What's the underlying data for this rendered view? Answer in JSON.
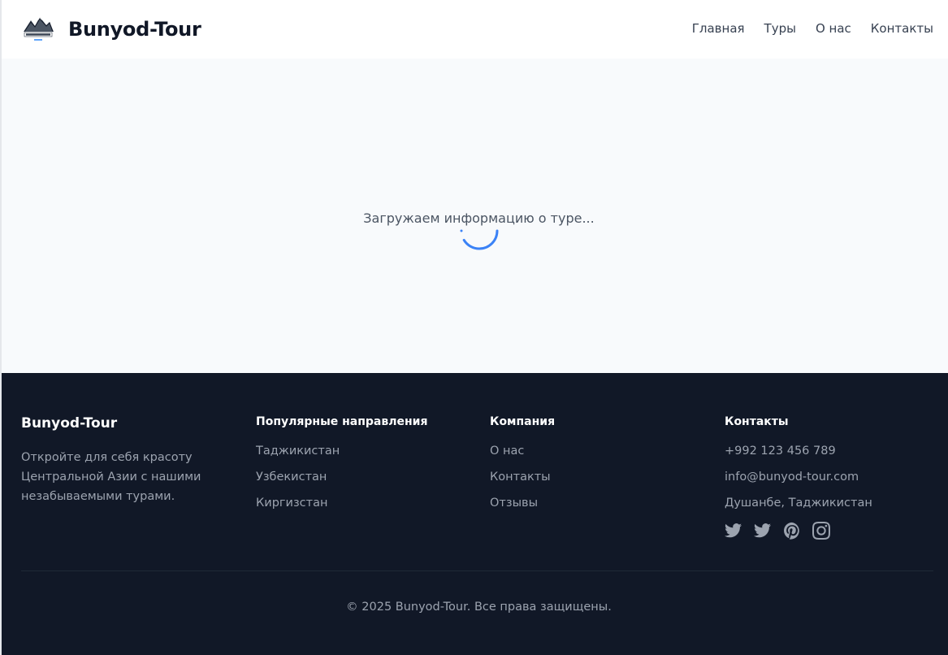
{
  "header": {
    "brand": "Bunyod-Tour",
    "nav": [
      "Главная",
      "Туры",
      "О нас",
      "Контакты"
    ]
  },
  "main": {
    "loading_text": "Загружаем информацию о туре..."
  },
  "footer": {
    "brand": "Bunyod-Tour",
    "description": "Откройте для себя красоту Центральной Азии с нашими незабываемыми турами.",
    "destinations": {
      "title": "Популярные направления",
      "items": [
        "Таджикистан",
        "Узбекистан",
        "Киргизстан"
      ]
    },
    "company": {
      "title": "Компания",
      "items": [
        "О нас",
        "Контакты",
        "Отзывы"
      ]
    },
    "contacts": {
      "title": "Контакты",
      "phone": "+992 123 456 789",
      "email": "info@bunyod-tour.com",
      "address": "Душанбе, Таджикистан"
    },
    "socials": [
      "twitter-icon",
      "twitter-icon",
      "pinterest-icon",
      "instagram-icon"
    ],
    "copyright": "© 2025 Bunyod-Tour. Все права защищены."
  },
  "colors": {
    "footer_bg": "#111827",
    "spinner": "#3b82f6",
    "page_bg": "#f8fafc"
  }
}
